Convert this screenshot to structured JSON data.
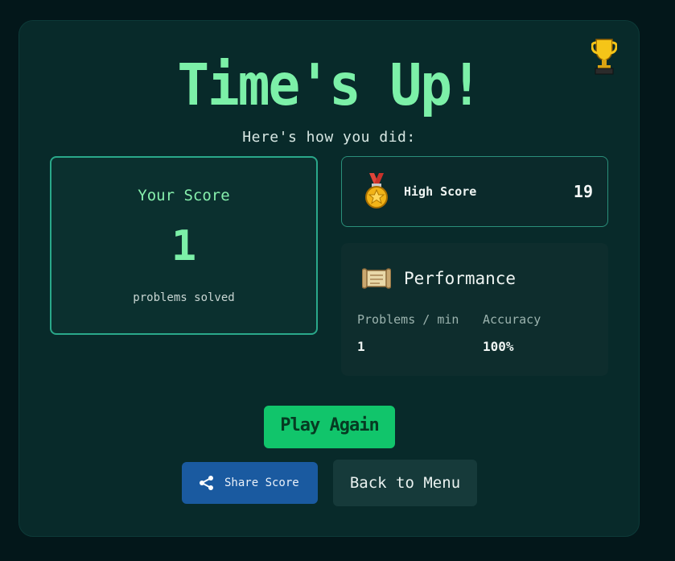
{
  "header": {
    "title": "Time's Up!",
    "subtitle": "Here's how you did:",
    "trophy_icon": "trophy-icon"
  },
  "score": {
    "label": "Your Score",
    "value": "1",
    "sub": "problems solved"
  },
  "high_score": {
    "icon": "medal-icon",
    "label": "High Score",
    "value": "19"
  },
  "performance": {
    "icon": "scroll-icon",
    "title": "Performance",
    "columns": [
      {
        "label": "Problems / min",
        "value": "1"
      },
      {
        "label": "Accuracy",
        "value": "100%"
      }
    ]
  },
  "actions": {
    "play_again": "Play Again",
    "share": "Share Score",
    "share_icon": "share-icon",
    "back": "Back to Menu"
  },
  "colors": {
    "background": "#03171a",
    "card": "#082a2a",
    "accent_green": "#7cf0a8",
    "play_button": "#11c56b",
    "share_button": "#1a5aa0"
  }
}
